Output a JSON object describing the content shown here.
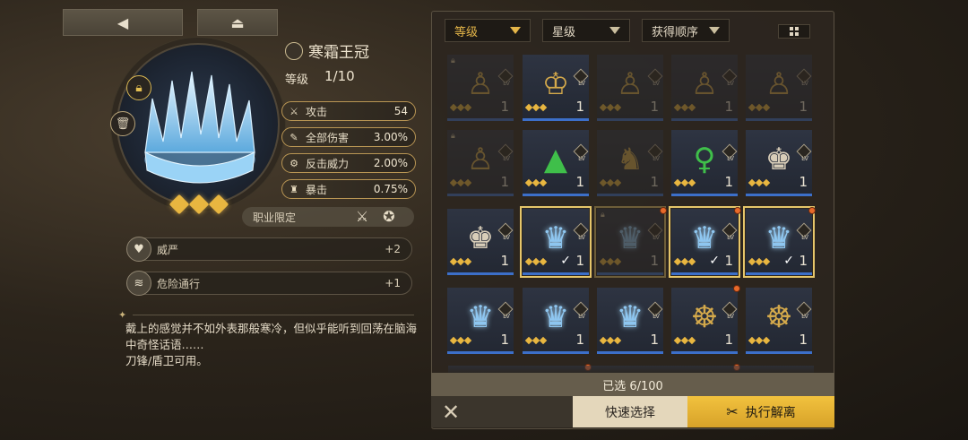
{
  "item": {
    "name": "寒霜王冠",
    "level_label": "等级",
    "level_value": "1/10",
    "stars": 3,
    "stats": [
      {
        "name": "攻击",
        "value": "54",
        "icon": "sword-icon"
      },
      {
        "name": "全部伤害",
        "value": "3.00%",
        "icon": "blade-icon"
      },
      {
        "name": "反击威力",
        "value": "2.00%",
        "icon": "gear-icon"
      },
      {
        "name": "暴击",
        "value": "0.75%",
        "icon": "goblet-icon"
      }
    ],
    "profession_label": "职业限定",
    "perks": [
      {
        "name": "威严",
        "value": "+2"
      },
      {
        "name": "危险通行",
        "value": "+1"
      }
    ],
    "description": "戴上的感觉并不如外表那般寒冷，但似乎能听到回荡在脑海中奇怪话语……",
    "usable_by": "刀锋/盾卫可用。"
  },
  "filters": {
    "sort_level": "等级",
    "sort_star": "星级",
    "sort_order": "获得顺序"
  },
  "grid": {
    "rows": [
      [
        {
          "kind": "statue",
          "locked": true,
          "dim": true,
          "level": "1"
        },
        {
          "kind": "gold-bust",
          "locked": false,
          "dim": false,
          "level": "1"
        },
        {
          "kind": "statue",
          "locked": false,
          "dim": true,
          "level": "1"
        },
        {
          "kind": "statue",
          "locked": false,
          "dim": true,
          "level": "1"
        },
        {
          "kind": "statue",
          "locked": false,
          "dim": true,
          "level": "1"
        }
      ],
      [
        {
          "kind": "statue",
          "locked": true,
          "dim": true,
          "level": "1"
        },
        {
          "kind": "green-crystal",
          "locked": false,
          "dim": false,
          "level": "1"
        },
        {
          "kind": "trophy",
          "locked": false,
          "dim": true,
          "level": "1"
        },
        {
          "kind": "green-dancer",
          "locked": false,
          "dim": false,
          "level": "1"
        },
        {
          "kind": "nutcracker",
          "locked": false,
          "dim": false,
          "level": "1"
        }
      ],
      [
        {
          "kind": "nutcracker",
          "locked": false,
          "dim": false,
          "level": "1"
        },
        {
          "kind": "ice-crown",
          "locked": false,
          "dim": false,
          "level": "1",
          "selected": true,
          "checked": true
        },
        {
          "kind": "ice-crown",
          "locked": true,
          "dim": true,
          "level": "1",
          "selected": true
        },
        {
          "kind": "ice-crown",
          "locked": false,
          "dim": false,
          "level": "1",
          "selected": true,
          "checked": true
        },
        {
          "kind": "ice-crown",
          "locked": false,
          "dim": false,
          "level": "1",
          "selected": true,
          "checked": true
        }
      ],
      [
        {
          "kind": "ice-crown",
          "locked": false,
          "dim": false,
          "level": "1"
        },
        {
          "kind": "ice-crown",
          "locked": false,
          "dim": false,
          "level": "1"
        },
        {
          "kind": "ice-crown",
          "locked": false,
          "dim": false,
          "level": "1"
        },
        {
          "kind": "ship-wheel",
          "locked": false,
          "dim": false,
          "level": "1"
        },
        {
          "kind": "ship-wheel",
          "locked": false,
          "dim": false,
          "level": "1"
        }
      ]
    ],
    "level_prefix": "LV"
  },
  "footer": {
    "selected_count": "已选 6/100",
    "quick_select": "快速选择",
    "execute": "执行解离",
    "close_symbol": "✕"
  }
}
